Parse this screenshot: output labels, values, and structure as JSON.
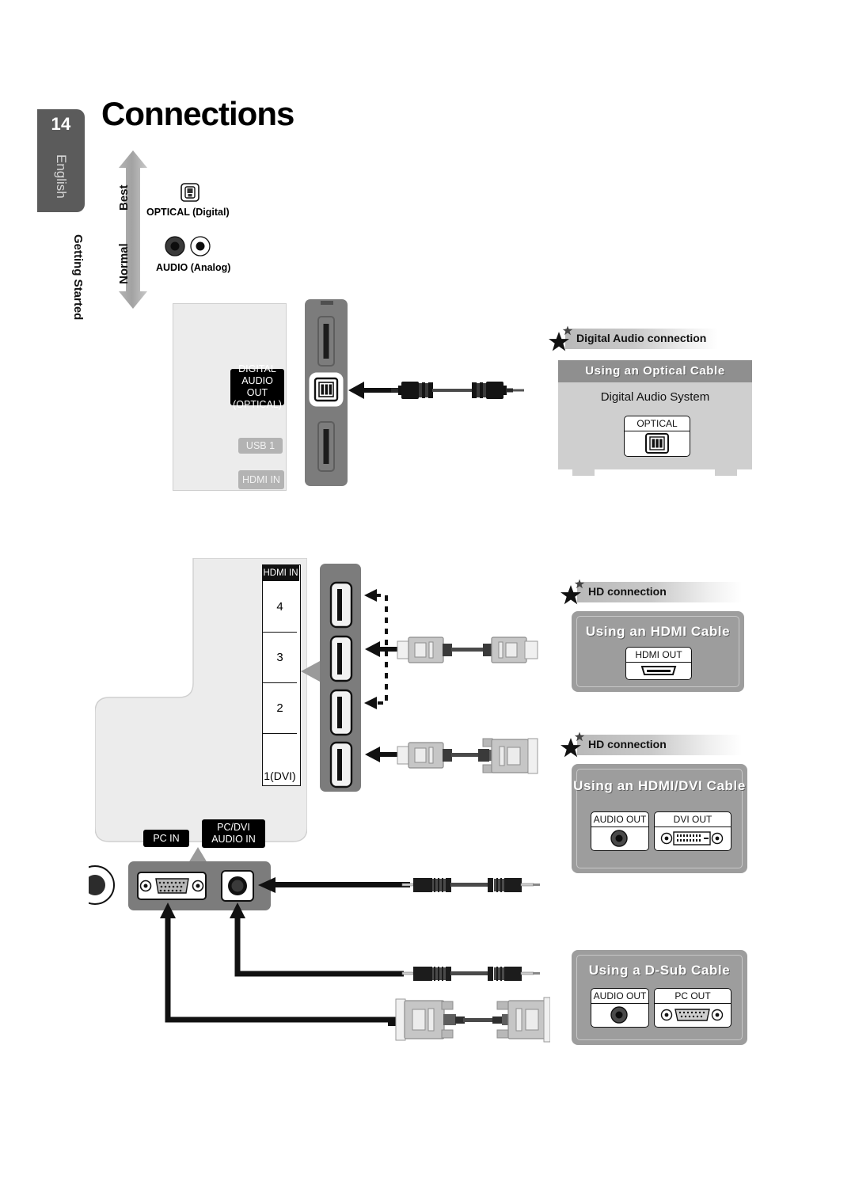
{
  "page": {
    "number": "14",
    "language": "English",
    "section": "Getting Started",
    "title": "Connections"
  },
  "quality_scale": {
    "top_label": "Best",
    "bottom_label": "Normal"
  },
  "legend": {
    "optical": "OPTICAL (Digital)",
    "audio": "AUDIO (Analog)"
  },
  "tv_top": {
    "jack_label": "DIGITAL\nAUDIO OUT\n(OPTICAL)",
    "jack_label_lines": [
      "DIGITAL",
      "AUDIO OUT",
      "(OPTICAL)"
    ],
    "usb_label": "USB 1",
    "hdmi_label": "HDMI IN"
  },
  "tv_bottom": {
    "hdmi_header": "HDMI IN",
    "hdmi_ports": [
      "4",
      "3",
      "2",
      "1(DVI)"
    ],
    "pc_in_label": "PC IN",
    "pc_dvi_audio_in_lines": [
      "PC/DVI",
      "AUDIO IN"
    ]
  },
  "callouts": [
    {
      "id": "digital-audio",
      "badge": "Digital Audio connection",
      "title": "Using an Optical Cable",
      "device_caption": "Digital Audio System",
      "ports": [
        {
          "label": "OPTICAL",
          "type": "optical"
        }
      ]
    },
    {
      "id": "hdmi",
      "badge": "HD connection",
      "title": "Using an HDMI Cable",
      "device_caption": "",
      "ports": [
        {
          "label": "HDMI OUT",
          "type": "hdmi"
        }
      ]
    },
    {
      "id": "hdmi-dvi",
      "badge": "HD connection",
      "title": "Using an HDMI/DVI Cable",
      "device_caption": "",
      "ports": [
        {
          "label": "AUDIO OUT",
          "type": "rca"
        },
        {
          "label": "DVI OUT",
          "type": "dvi"
        }
      ]
    },
    {
      "id": "d-sub",
      "badge": "",
      "title": "Using a D-Sub Cable",
      "device_caption": "",
      "ports": [
        {
          "label": "AUDIO OUT",
          "type": "rca"
        },
        {
          "label": "PC OUT",
          "type": "dsub"
        }
      ]
    }
  ],
  "icons": {
    "star": "star-icon",
    "optical_jack": "optical-jack-icon",
    "rca_jack": "rca-jack-icon",
    "hdmi_port": "hdmi-port-icon",
    "dvi_port": "dvi-port-icon",
    "dsub_port": "dsub-port-icon",
    "arrow": "arrow-icon"
  },
  "colors": {
    "tab_grey": "#5b5b5b",
    "panel_grey": "#9d9d9d",
    "port_strip": "#7c7c7c",
    "tv_body": "#ececec",
    "tag_black": "#000000",
    "tag_grey": "#b3b3b3"
  }
}
